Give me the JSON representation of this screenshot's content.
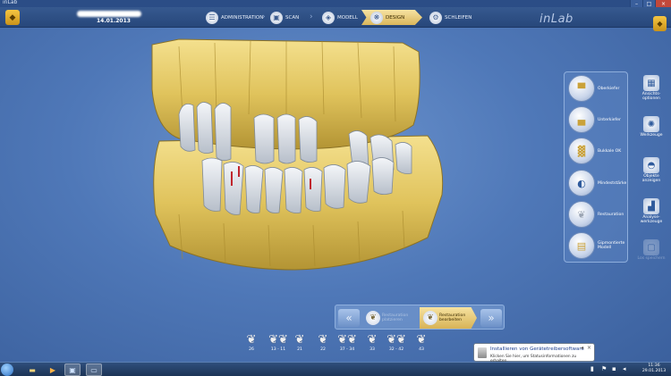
{
  "window": {
    "title": "inLab"
  },
  "header": {
    "patient_date": "14.01.2013",
    "brand": "inLab",
    "steps": [
      {
        "label": "ADMINISTRATION",
        "icon": "admin-icon"
      },
      {
        "label": "SCAN",
        "icon": "scan-icon"
      },
      {
        "label": "MODELL",
        "icon": "model-icon"
      },
      {
        "label": "DESIGN",
        "icon": "design-icon",
        "active": true
      },
      {
        "label": "SCHLEIFEN",
        "icon": "milling-icon"
      }
    ]
  },
  "tools": [
    {
      "label": "Oberkiefer",
      "icon": "upper-jaw-icon"
    },
    {
      "label": "Unterkiefer",
      "icon": "lower-jaw-icon"
    },
    {
      "label": "Bukkale OK",
      "icon": "buccal-icon"
    },
    {
      "label": "Mindeststärke",
      "icon": "min-thickness-icon"
    },
    {
      "label": "Restauration",
      "icon": "restoration-icon"
    },
    {
      "label": "Gipmontierte Modell",
      "icon": "plaster-model-icon"
    }
  ],
  "side_actions": [
    {
      "label": "Ansichts-optionen",
      "icon": "view-options-icon"
    },
    {
      "label": "Werkzeuge",
      "icon": "tools-icon"
    },
    {
      "label": "Objekte anzeigen",
      "icon": "show-objects-icon"
    },
    {
      "label": "Analyse-werkzeuge",
      "icon": "analysis-icon"
    },
    {
      "label": "Los speichern",
      "icon": "save-icon",
      "disabled": true
    }
  ],
  "phases": {
    "prev": "«",
    "next": "»",
    "items": [
      {
        "label": "Restauration platzieren",
        "state": "dim"
      },
      {
        "label": "Restauration bearbeiten",
        "state": "active"
      }
    ]
  },
  "restorations": [
    {
      "label": "26"
    },
    {
      "label": "13 - 11"
    },
    {
      "label": "21"
    },
    {
      "label": "22"
    },
    {
      "label": "37 - 34"
    },
    {
      "label": "33"
    },
    {
      "label": "32 - 42"
    },
    {
      "label": "43"
    }
  ],
  "notification": {
    "title": "Installieren von Gerätetreibersoftware",
    "body": "Klicken Sie hier, um Statusinformationen zu erhalten."
  },
  "taskbar": {
    "time": "11:36",
    "date": "29.01.2013"
  },
  "colors": {
    "model": "#e4cc6a",
    "teeth": "#dfe4ea",
    "accent": "#d8b356"
  }
}
